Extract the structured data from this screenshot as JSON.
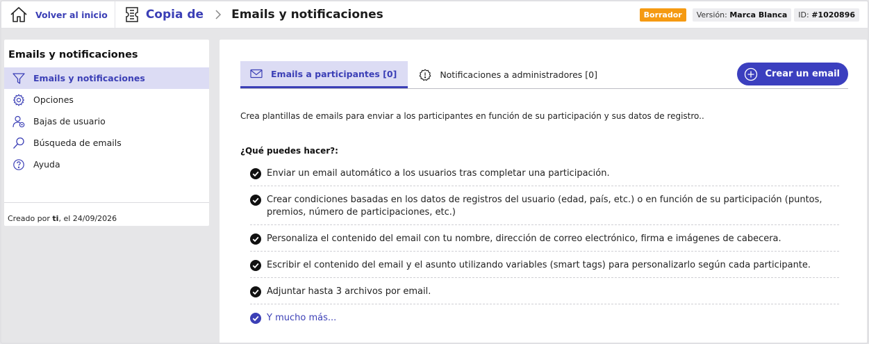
{
  "header": {
    "home_label": "Volver al inicio",
    "breadcrumb_parent": "Copia de",
    "page_title": "Emails y notificaciones",
    "status_badge": "Borrador",
    "version_label": "Versión:",
    "version_value": "Marca Blanca",
    "id_label": "ID:",
    "id_value": "#1020896"
  },
  "sidebar": {
    "title": "Emails y notificaciones",
    "items": [
      {
        "label": "Emails y notificaciones",
        "icon": "filter-icon",
        "active": true
      },
      {
        "label": "Opciones",
        "icon": "gear-icon",
        "active": false
      },
      {
        "label": "Bajas de usuario",
        "icon": "user-remove-icon",
        "active": false
      },
      {
        "label": "Búsqueda de emails",
        "icon": "search-icon",
        "active": false
      },
      {
        "label": "Ayuda",
        "icon": "help-icon",
        "active": false
      }
    ],
    "created_prefix": "Creado por",
    "created_by": "ti",
    "created_suffix": ", el 24/09/2026"
  },
  "main": {
    "tabs": [
      {
        "label": "Emails a participantes [0]",
        "icon": "envelope-icon",
        "active": true
      },
      {
        "label": "Notificaciones a administradores [0]",
        "icon": "alert-icon",
        "active": false
      }
    ],
    "create_button": "Crear un email",
    "intro": "Crea plantillas de emails para enviar a los participantes en función de su participación y sus datos de registro..",
    "what_title": "¿Qué puedes hacer?:",
    "features": [
      "Enviar un email automático a los usuarios tras completar una participación.",
      "Crear condiciones basadas en los datos de registros del usuario (edad, país, etc.) o en función de su participación (puntos, premios, número de participaciones, etc.)",
      "Personaliza el contenido del email con tu nombre, dirección de correo electrónico, firma e imágenes de cabecera.",
      "Escribir el contenido del email y el asunto utilizando variables (smart tags) para personalizarlo según cada participante.",
      "Adjuntar hasta 3 archivos por email."
    ],
    "more_link": "Y mucho más..."
  },
  "colors": {
    "accent": "#3b3fb6",
    "accent_bg": "#dcdcf4",
    "draft_badge": "#f59a12",
    "page_bg": "#e6e6e8"
  }
}
